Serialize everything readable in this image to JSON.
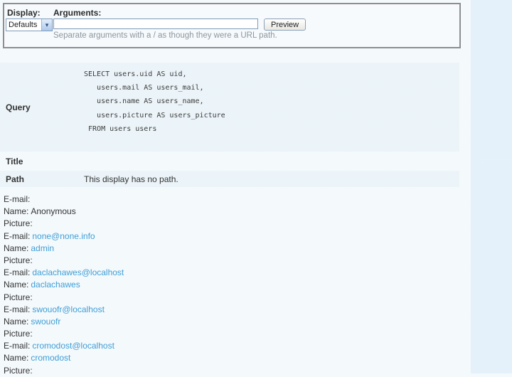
{
  "colors": {
    "link": "#3e9ed6",
    "section_bg": "#e4f0f7",
    "rail_bg": "#dcecf8"
  },
  "argument_form": {
    "display_label": "Display:",
    "display_value": "Defaults",
    "arguments_label": "Arguments:",
    "arguments_value": "",
    "preview_button_label": "Preview",
    "arguments_help": "Separate arguments with a / as though they were a URL path."
  },
  "preview_info": {
    "query": {
      "label": "Query",
      "sql": "SELECT users.uid AS uid,\n   users.mail AS users_mail,\n   users.name AS users_name,\n   users.picture AS users_picture\n FROM users users"
    },
    "title": {
      "label": "Title",
      "value": ""
    },
    "path": {
      "label": "Path",
      "value": "This display has no path."
    }
  },
  "results": {
    "rows": [
      {
        "label": "E-mail:",
        "value": "",
        "is_link": false
      },
      {
        "label": "Name:",
        "value": "Anonymous",
        "is_link": false
      },
      {
        "label": "Picture:",
        "value": "",
        "is_link": false
      },
      {
        "label": "E-mail:",
        "value": "none@none.info",
        "is_link": true
      },
      {
        "label": "Name:",
        "value": "admin",
        "is_link": true
      },
      {
        "label": "Picture:",
        "value": "",
        "is_link": false
      },
      {
        "label": "E-mail:",
        "value": "daclachawes@localhost",
        "is_link": true
      },
      {
        "label": "Name:",
        "value": "daclachawes",
        "is_link": true
      },
      {
        "label": "Picture:",
        "value": "",
        "is_link": false
      },
      {
        "label": "E-mail:",
        "value": "swouofr@localhost",
        "is_link": true
      },
      {
        "label": "Name:",
        "value": "swouofr",
        "is_link": true
      },
      {
        "label": "Picture:",
        "value": "",
        "is_link": false
      },
      {
        "label": "E-mail:",
        "value": "cromodost@localhost",
        "is_link": true
      },
      {
        "label": "Name:",
        "value": "cromodost",
        "is_link": true
      },
      {
        "label": "Picture:",
        "value": "",
        "is_link": false
      }
    ]
  }
}
